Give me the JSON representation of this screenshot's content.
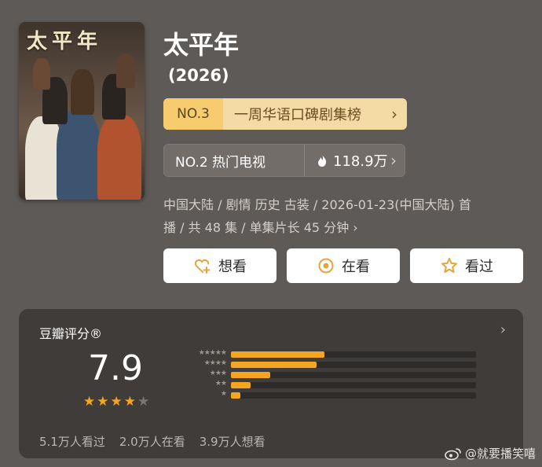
{
  "poster": {
    "title": "太平年"
  },
  "title": "太平年",
  "year": "(2026)",
  "rank_primary": {
    "badge": "NO.3",
    "label": "一周华语口碑剧集榜",
    "chevron": "›"
  },
  "rank_secondary": {
    "badge": "NO.2 热门电视",
    "hot_value": "118.9万",
    "chevron": "›"
  },
  "meta": {
    "line1": "中国大陆 / 剧情 历史 古装 / 2026-01-23(中国大陆) 首",
    "line2": "播 / 共 48 集 / 单集片长 45 分钟",
    "chevron": "›"
  },
  "actions": [
    {
      "label": "想看",
      "icon": "heart-plus-icon"
    },
    {
      "label": "在看",
      "icon": "target-icon"
    },
    {
      "label": "看过",
      "icon": "star-outline-icon"
    }
  ],
  "rating": {
    "label": "豆瓣评分®",
    "chevron": "›",
    "score": "7.9",
    "stars_filled": 4,
    "stars_total": 5,
    "distribution": [
      {
        "stars": "★★★★★",
        "fraction": 0.38
      },
      {
        "stars": "★★★★",
        "fraction": 0.35
      },
      {
        "stars": "★★★",
        "fraction": 0.16
      },
      {
        "stars": "★★",
        "fraction": 0.08
      },
      {
        "stars": "★",
        "fraction": 0.04
      }
    ],
    "counts": [
      "5.1万人看过",
      "2.0万人在看",
      "3.9万人想看"
    ]
  },
  "watermark": "@就要播笑嘻",
  "colors": {
    "accent": "#f4a623",
    "rank_gold": "#f6cc6e",
    "rank_light": "#f4dba6",
    "heart": "#e8a33a",
    "target": "#e8a33a",
    "star": "#e8a33a"
  }
}
